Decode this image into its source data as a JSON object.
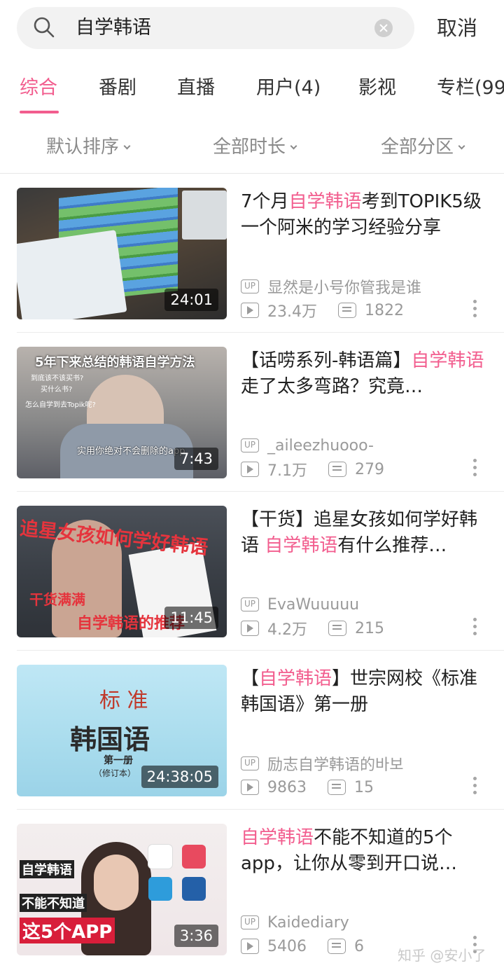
{
  "search": {
    "query": "自学韩语",
    "cancel_label": "取消"
  },
  "tabs": [
    {
      "label": "综合"
    },
    {
      "label": "番剧"
    },
    {
      "label": "直播"
    },
    {
      "label": "用户(4)"
    },
    {
      "label": "影视"
    },
    {
      "label": "专栏(99"
    }
  ],
  "filters": [
    {
      "label": "默认排序"
    },
    {
      "label": "全部时长"
    },
    {
      "label": "全部分区"
    }
  ],
  "accent_color": "#f25d8e",
  "results": [
    {
      "title_parts": [
        "7个月",
        "自学韩语",
        "考到TOPIK5级 一个阿米的学习经验分享"
      ],
      "duration": "24:01",
      "up_badge": "UP",
      "uploader": "显然是小号你管我是谁",
      "views": "23.4万",
      "danmaku": "1822"
    },
    {
      "title_parts": [
        "【话唠系列-韩语篇】",
        "自学韩语",
        "走了太多弯路？究竟…"
      ],
      "duration": "7:43",
      "up_badge": "UP",
      "uploader": "_aileezhuooo-",
      "views": "7.1万",
      "danmaku": "279",
      "thumb_caption": "5年下来总结的韩语自学方法",
      "thumb_lines": [
        "到底该不该买书?",
        "买什么书?",
        "怎么自学到去Topik呢?"
      ],
      "thumb_bottom": "实用你绝对不会删除的app"
    },
    {
      "title_parts": [
        "【干货】追星女孩如何学好韩语 ",
        "自学韩语",
        "有什么推荐…"
      ],
      "duration": "11:45",
      "up_badge": "UP",
      "uploader": "EvaWuuuuu",
      "views": "4.2万",
      "danmaku": "215",
      "thumb_caption": "追星女孩如何学好韩语",
      "thumb_caption2": "干货满满",
      "thumb_caption3": "自学韩语的推荐"
    },
    {
      "title_parts": [
        "【",
        "自学韩语",
        "】世宗网校《标准韩国语》第一册"
      ],
      "duration": "24:38:05",
      "up_badge": "UP",
      "uploader": "励志自学韩语的바보",
      "views": "9863",
      "danmaku": "15",
      "thumb_caption": "标 准",
      "thumb_caption2": "韩国语",
      "thumb_caption3": "第一册",
      "thumb_caption4": "（修订本）"
    },
    {
      "title_parts": [
        "",
        "自学韩语",
        "不能不知道的5个app，让你从零到开口说…"
      ],
      "duration": "3:36",
      "up_badge": "UP",
      "uploader": "Kaidediary",
      "views": "5406",
      "danmaku": "6",
      "thumb_caption": "自学韩语",
      "thumb_caption2": "不能不知道",
      "thumb_caption3": "这5个APP"
    }
  ],
  "watermark": "知乎 @安小了"
}
